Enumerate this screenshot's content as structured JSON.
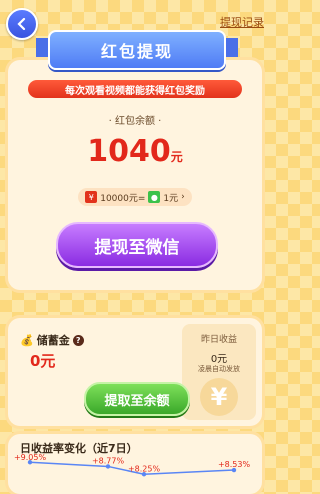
{
  "header": {
    "title": "红包提现",
    "record_link": "提现记录"
  },
  "notice": "每次观看视频都能获得红包奖励",
  "balance": {
    "label": "· 红包余额 ·",
    "amount": "1040",
    "unit": "元"
  },
  "exchange": {
    "coins": "10000元=",
    "cash": "1元",
    "arrow": "›"
  },
  "withdraw_wechat_label": "提现至微信",
  "savings": {
    "label": "储蓄金",
    "amount": "0元",
    "yesterday_label": "昨日收益",
    "yesterday_amount": "0元",
    "auto_note": "凌晨自动发放",
    "to_balance_label": "提取至余额"
  },
  "chart_data": {
    "type": "line",
    "title": "日收益率变化（近7日）",
    "series": [
      {
        "values": [
          9.05,
          8.77,
          8.25,
          8.53
        ]
      }
    ],
    "labels": [
      "+9.05%",
      "+8.77%",
      "+8.25%",
      "+8.53%"
    ]
  }
}
